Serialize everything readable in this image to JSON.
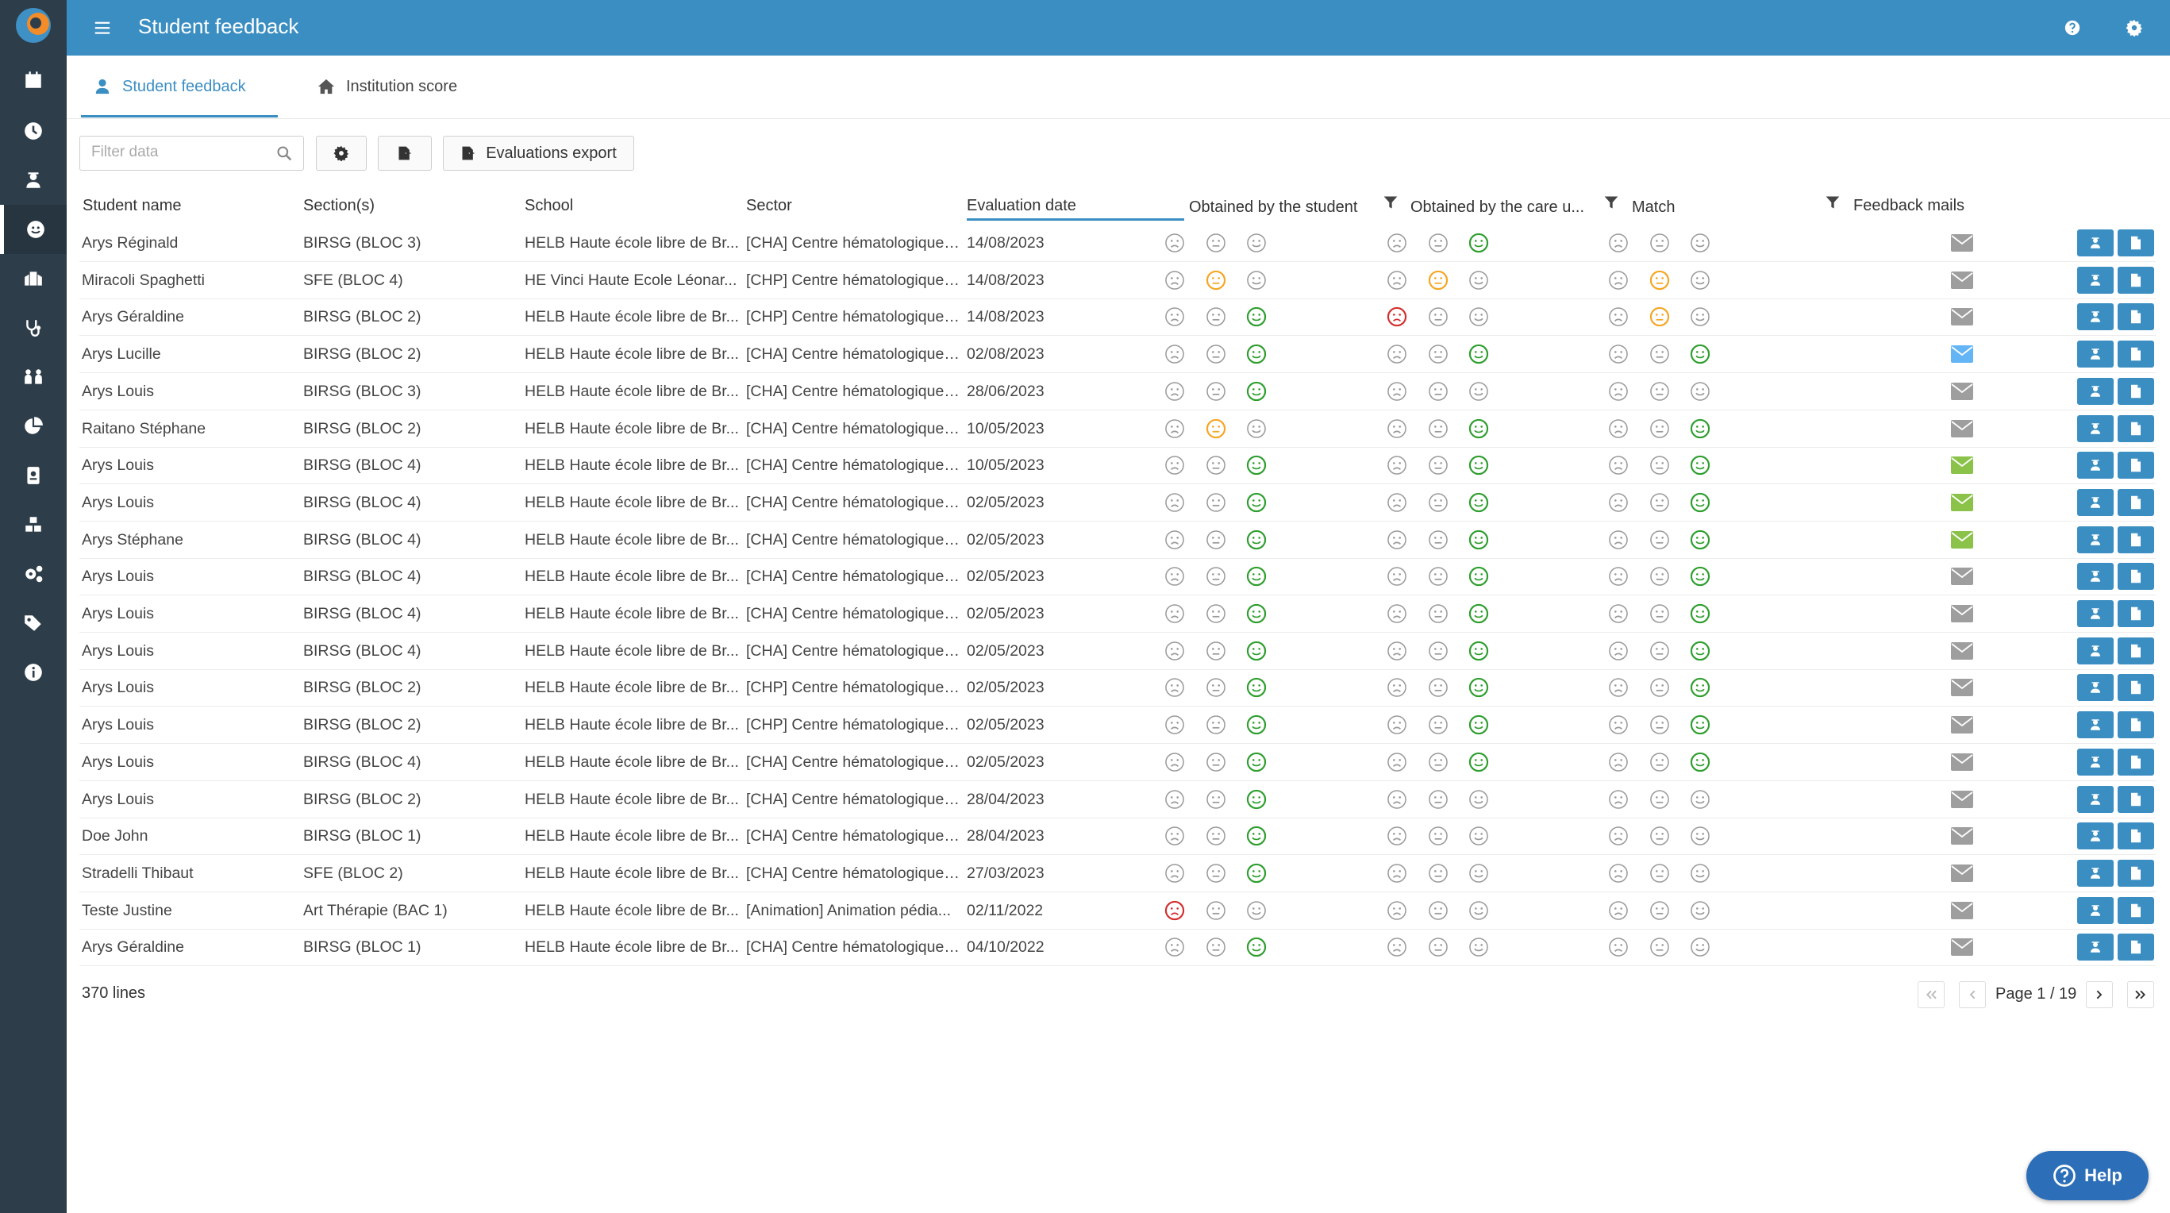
{
  "header": {
    "title": "Student feedback"
  },
  "tabs": [
    {
      "label": "Student feedback",
      "icon": "user-icon",
      "active": true
    },
    {
      "label": "Institution score",
      "icon": "home-icon",
      "active": false
    }
  ],
  "toolbar": {
    "filter_placeholder": "Filter data",
    "export_label": "Evaluations export"
  },
  "columns": {
    "student": "Student name",
    "section": "Section(s)",
    "school": "School",
    "sector": "Sector",
    "date": "Evaluation date",
    "by_student": "Obtained by the student",
    "by_care": "Obtained by the care u...",
    "match": "Match",
    "mails": "Feedback mails"
  },
  "colors": {
    "primary": "#3b8ec2",
    "sidebar": "#2d3e4a",
    "face_grey": "#9a9a9a",
    "face_red": "#d32f2f",
    "face_orange": "#f5a623",
    "face_green": "#2e9e2e",
    "mail_grey": "#9e9e9e",
    "mail_blue": "#64b5f6",
    "mail_green": "#8bc34a"
  },
  "rows": [
    {
      "student": "Arys Réginald",
      "section": "BIRSG (BLOC 3)",
      "school": "HELB Haute école libre de Br...",
      "sector": "[CHA] Centre hématologique ...",
      "date": "14/08/2023",
      "student_score": "none",
      "care_score": "good",
      "match": "none",
      "mail": "grey"
    },
    {
      "student": "Miracoli Spaghetti",
      "section": "SFE (BLOC 4)",
      "school": "HE Vinci Haute Ecole Léonar...",
      "sector": "[CHP] Centre hématologique ...",
      "date": "14/08/2023",
      "student_score": "mid",
      "care_score": "mid",
      "match": "mid",
      "mail": "grey"
    },
    {
      "student": "Arys Géraldine",
      "section": "BIRSG (BLOC 2)",
      "school": "HELB Haute école libre de Br...",
      "sector": "[CHP] Centre hématologique ...",
      "date": "14/08/2023",
      "student_score": "good",
      "care_score": "bad",
      "match": "mid",
      "mail": "grey"
    },
    {
      "student": "Arys Lucille",
      "section": "BIRSG (BLOC 2)",
      "school": "HELB Haute école libre de Br...",
      "sector": "[CHA] Centre hématologique ...",
      "date": "02/08/2023",
      "student_score": "good",
      "care_score": "good",
      "match": "good",
      "mail": "blue"
    },
    {
      "student": "Arys Louis",
      "section": "BIRSG (BLOC 3)",
      "school": "HELB Haute école libre de Br...",
      "sector": "[CHA] Centre hématologique ...",
      "date": "28/06/2023",
      "student_score": "good",
      "care_score": "none",
      "match": "none",
      "mail": "grey"
    },
    {
      "student": "Raitano Stéphane",
      "section": "BIRSG (BLOC 2)",
      "school": "HELB Haute école libre de Br...",
      "sector": "[CHA] Centre hématologique ...",
      "date": "10/05/2023",
      "student_score": "mid",
      "care_score": "good",
      "match": "good",
      "mail": "grey"
    },
    {
      "student": "Arys Louis",
      "section": "BIRSG (BLOC 4)",
      "school": "HELB Haute école libre de Br...",
      "sector": "[CHA] Centre hématologique ...",
      "date": "10/05/2023",
      "student_score": "good",
      "care_score": "good",
      "match": "good",
      "mail": "green"
    },
    {
      "student": "Arys Louis",
      "section": "BIRSG (BLOC 4)",
      "school": "HELB Haute école libre de Br...",
      "sector": "[CHA] Centre hématologique ...",
      "date": "02/05/2023",
      "student_score": "good",
      "care_score": "good",
      "match": "good",
      "mail": "green"
    },
    {
      "student": "Arys Stéphane",
      "section": "BIRSG (BLOC 4)",
      "school": "HELB Haute école libre de Br...",
      "sector": "[CHA] Centre hématologique ...",
      "date": "02/05/2023",
      "student_score": "good",
      "care_score": "good",
      "match": "good",
      "mail": "green"
    },
    {
      "student": "Arys Louis",
      "section": "BIRSG (BLOC 4)",
      "school": "HELB Haute école libre de Br...",
      "sector": "[CHA] Centre hématologique ...",
      "date": "02/05/2023",
      "student_score": "good",
      "care_score": "good",
      "match": "good",
      "mail": "grey"
    },
    {
      "student": "Arys Louis",
      "section": "BIRSG (BLOC 4)",
      "school": "HELB Haute école libre de Br...",
      "sector": "[CHA] Centre hématologique ...",
      "date": "02/05/2023",
      "student_score": "good",
      "care_score": "good",
      "match": "good",
      "mail": "grey"
    },
    {
      "student": "Arys Louis",
      "section": "BIRSG (BLOC 4)",
      "school": "HELB Haute école libre de Br...",
      "sector": "[CHA] Centre hématologique ...",
      "date": "02/05/2023",
      "student_score": "good",
      "care_score": "good",
      "match": "good",
      "mail": "grey"
    },
    {
      "student": "Arys Louis",
      "section": "BIRSG (BLOC 2)",
      "school": "HELB Haute école libre de Br...",
      "sector": "[CHP] Centre hématologique ...",
      "date": "02/05/2023",
      "student_score": "good",
      "care_score": "good",
      "match": "good",
      "mail": "grey"
    },
    {
      "student": "Arys Louis",
      "section": "BIRSG (BLOC 2)",
      "school": "HELB Haute école libre de Br...",
      "sector": "[CHP] Centre hématologique ...",
      "date": "02/05/2023",
      "student_score": "good",
      "care_score": "good",
      "match": "good",
      "mail": "grey"
    },
    {
      "student": "Arys Louis",
      "section": "BIRSG (BLOC 4)",
      "school": "HELB Haute école libre de Br...",
      "sector": "[CHA] Centre hématologique ...",
      "date": "02/05/2023",
      "student_score": "good",
      "care_score": "good",
      "match": "good",
      "mail": "grey"
    },
    {
      "student": "Arys Louis",
      "section": "BIRSG (BLOC 2)",
      "school": "HELB Haute école libre de Br...",
      "sector": "[CHA] Centre hématologique ...",
      "date": "28/04/2023",
      "student_score": "good",
      "care_score": "none",
      "match": "none",
      "mail": "grey"
    },
    {
      "student": "Doe John",
      "section": "BIRSG (BLOC 1)",
      "school": "HELB Haute école libre de Br...",
      "sector": "[CHA] Centre hématologique ...",
      "date": "28/04/2023",
      "student_score": "good",
      "care_score": "none",
      "match": "none",
      "mail": "grey"
    },
    {
      "student": "Stradelli Thibaut",
      "section": "SFE (BLOC 2)",
      "school": "HELB Haute école libre de Br...",
      "sector": "[CHA] Centre hématologique ...",
      "date": "27/03/2023",
      "student_score": "good",
      "care_score": "none",
      "match": "none",
      "mail": "grey"
    },
    {
      "student": "Teste Justine",
      "section": "Art Thérapie (BAC 1)",
      "school": "HELB Haute école libre de Br...",
      "sector": "[Animation] Animation pédia...",
      "date": "02/11/2022",
      "student_score": "bad",
      "care_score": "none",
      "match": "none",
      "mail": "grey"
    },
    {
      "student": "Arys Géraldine",
      "section": "BIRSG (BLOC 1)",
      "school": "HELB Haute école libre de Br...",
      "sector": "[CHA] Centre hématologique ...",
      "date": "04/10/2022",
      "student_score": "good",
      "care_score": "none",
      "match": "none",
      "mail": "grey"
    }
  ],
  "footer": {
    "lines_count": "370 lines",
    "page_label": "Page 1 / 19"
  },
  "help": {
    "label": "Help"
  }
}
